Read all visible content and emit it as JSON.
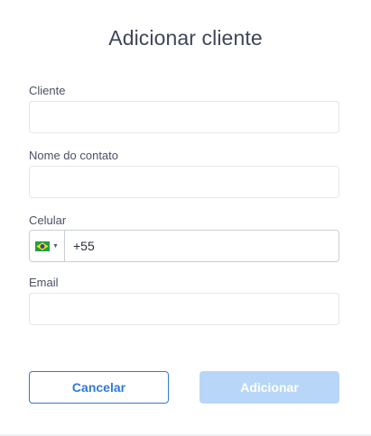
{
  "dialog": {
    "title": "Adicionar cliente"
  },
  "form": {
    "client": {
      "label": "Cliente",
      "value": "",
      "placeholder": ""
    },
    "contact_name": {
      "label": "Nome do contato",
      "value": "",
      "placeholder": ""
    },
    "phone": {
      "label": "Celular",
      "country_flag": "brazil-flag-icon",
      "value": "+55"
    },
    "email": {
      "label": "Email",
      "value": "",
      "placeholder": ""
    }
  },
  "actions": {
    "cancel_label": "Cancelar",
    "submit_label": "Adicionar"
  },
  "colors": {
    "primary": "#2f7ad6",
    "primary_disabled": "#b8d7f8",
    "text": "#3f4659",
    "border": "#e3e6ea"
  }
}
